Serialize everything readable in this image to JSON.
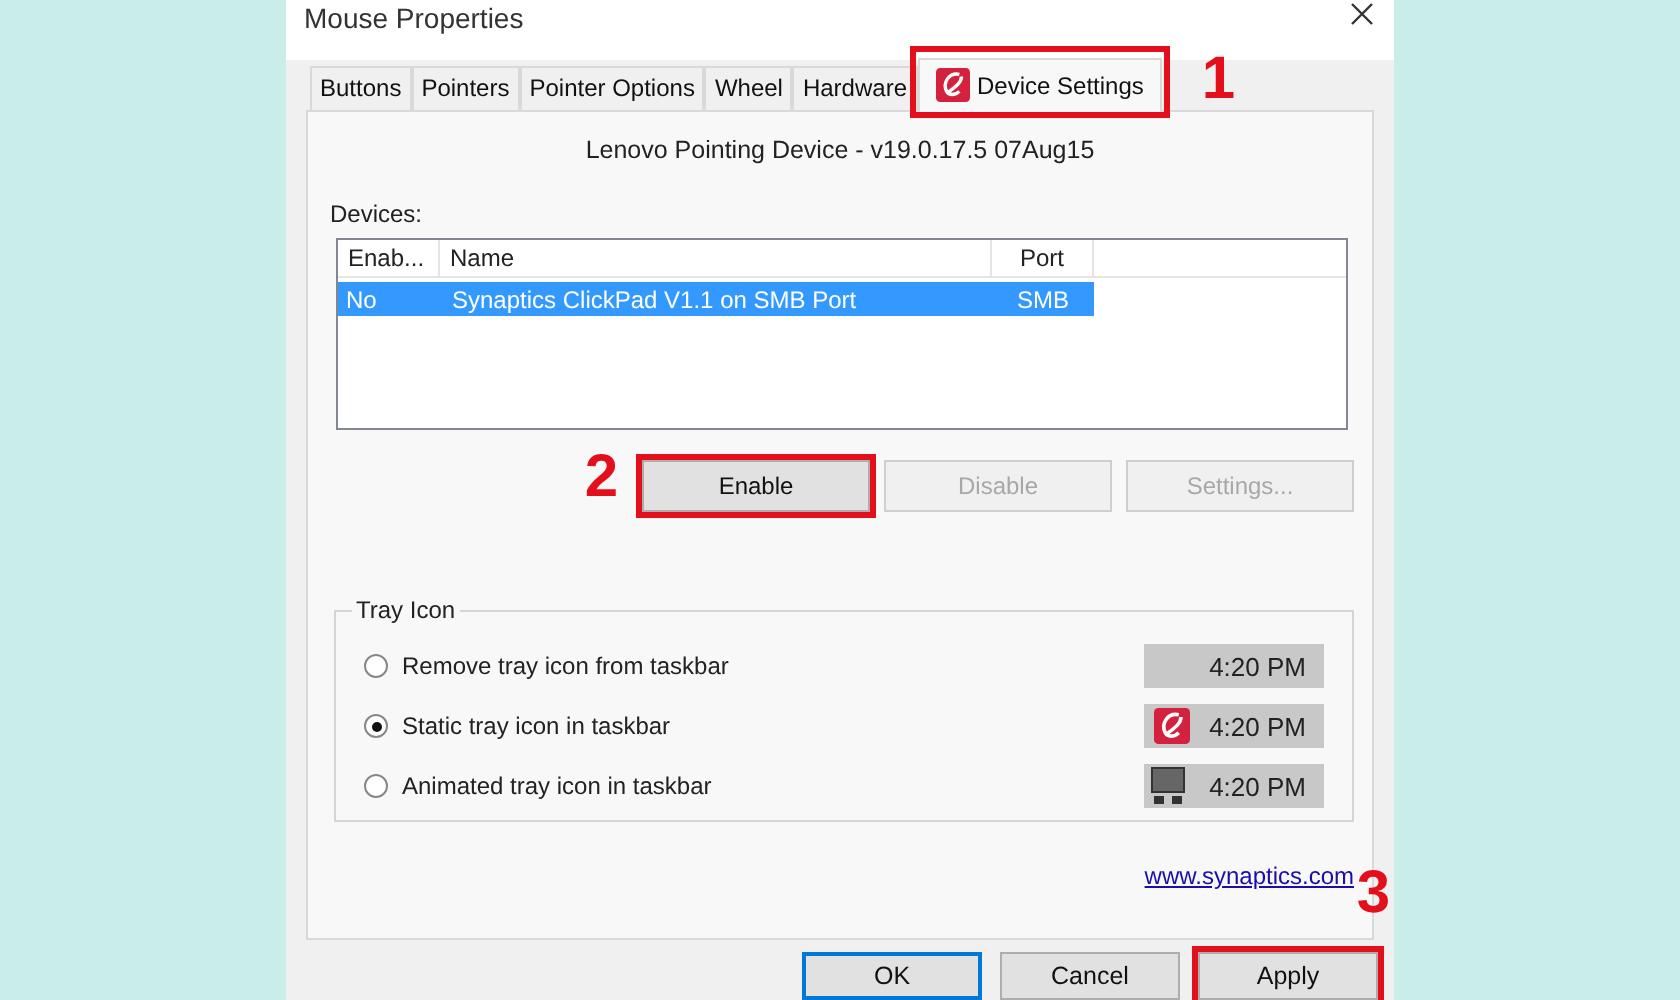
{
  "window": {
    "title": "Mouse Properties"
  },
  "tabs": [
    {
      "label": "Buttons",
      "selected": false,
      "kind": "plain"
    },
    {
      "label": "Pointers",
      "selected": false,
      "kind": "plain"
    },
    {
      "label": "Pointer Options",
      "selected": false,
      "kind": "plain"
    },
    {
      "label": "Wheel",
      "selected": false,
      "kind": "plain"
    },
    {
      "label": "Hardware",
      "selected": false,
      "kind": "plain"
    },
    {
      "label": "Device Settings",
      "selected": true,
      "kind": "synaptics",
      "marker": "1"
    }
  ],
  "driver_label": "Lenovo Pointing Device - v19.0.17.5 07Aug15",
  "devices": {
    "label": "Devices:",
    "columns": [
      "Enab...",
      "Name",
      "Port"
    ],
    "rows": [
      {
        "cells": [
          "No",
          "Synaptics ClickPad V1.1 on SMB Port",
          "SMB"
        ],
        "selected": true
      }
    ]
  },
  "device_buttons": [
    {
      "label": "Enable",
      "disabled": false,
      "marker": "2"
    },
    {
      "label": "Disable",
      "disabled": true
    },
    {
      "label": "Settings...",
      "disabled": true
    }
  ],
  "tray": {
    "title": "Tray Icon",
    "options": [
      {
        "label": "Remove tray icon from taskbar",
        "selected": false,
        "preview": {
          "kind": "none",
          "time": "4:20 PM"
        }
      },
      {
        "label": "Static tray icon in taskbar",
        "selected": true,
        "preview": {
          "kind": "synaptics",
          "time": "4:20 PM"
        }
      },
      {
        "label": "Animated tray icon in taskbar",
        "selected": false,
        "preview": {
          "kind": "monitor",
          "time": "4:20 PM"
        }
      }
    ]
  },
  "link": "www.synaptics.com",
  "dialog_buttons": [
    {
      "label": "OK",
      "default": true
    },
    {
      "label": "Cancel",
      "default": false
    },
    {
      "label": "Apply",
      "default": false,
      "marker": "3"
    }
  ]
}
